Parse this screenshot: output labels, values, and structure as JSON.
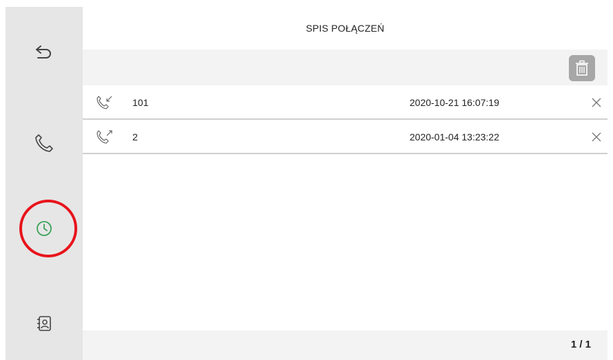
{
  "header": {
    "title": "SPIS POŁĄCZEŃ"
  },
  "sidebar": {
    "items": [
      {
        "name": "back",
        "icon": "back-arrow-icon"
      },
      {
        "name": "call",
        "icon": "phone-icon"
      },
      {
        "name": "history",
        "icon": "clock-icon",
        "active": true
      },
      {
        "name": "contacts",
        "icon": "contacts-book-icon"
      }
    ],
    "active_color": "#3aa35a",
    "highlight_color": "#e8141c"
  },
  "toolbar": {
    "delete_all_icon": "trash-icon"
  },
  "calls": [
    {
      "direction": "incoming",
      "icon": "incoming-call-icon",
      "number": "101",
      "datetime": "2020-10-21 16:07:19"
    },
    {
      "direction": "outgoing",
      "icon": "outgoing-call-icon",
      "number": "2",
      "datetime": "2020-01-04 13:23:22"
    }
  ],
  "footer": {
    "page": "1 / 1"
  }
}
